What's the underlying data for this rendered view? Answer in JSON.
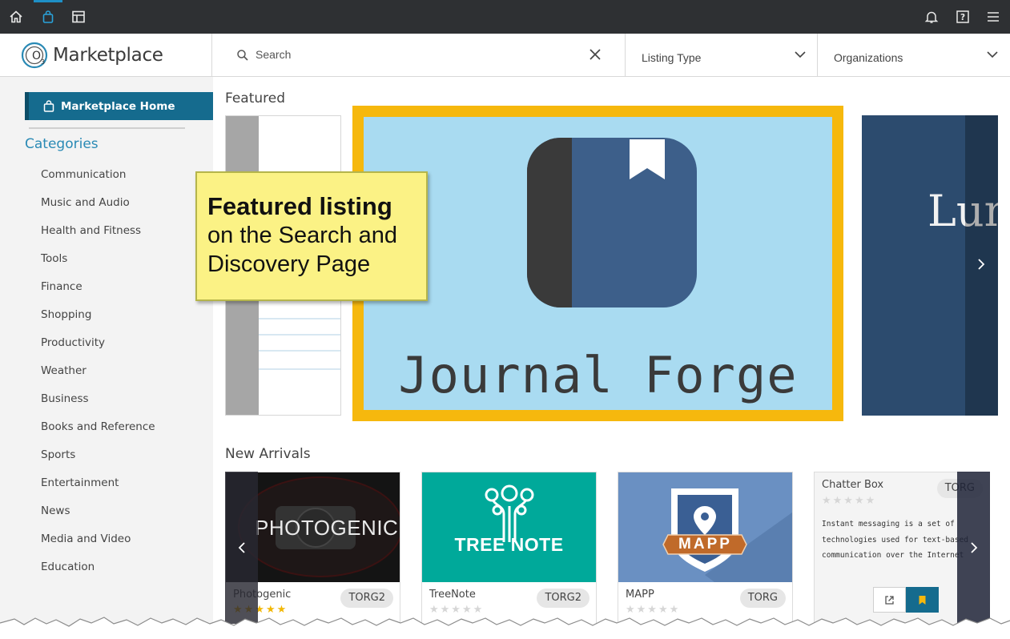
{
  "topbar": {
    "icons": [
      "home-icon",
      "shopping-bag-icon",
      "layout-icon",
      "bell-icon",
      "help-icon",
      "menu-icon"
    ],
    "active_color": "#1e8fc6"
  },
  "header": {
    "logo_text": "Marketplace",
    "logo_mark": "O3",
    "search_placeholder": "Search",
    "listing_type_label": "Listing Type",
    "organizations_label": "Organizations"
  },
  "sidebar": {
    "home_label": "Marketplace Home",
    "categories_title": "Categories",
    "categories": [
      "Communication",
      "Music and Audio",
      "Health and Fitness",
      "Tools",
      "Finance",
      "Shopping",
      "Productivity",
      "Weather",
      "Business",
      "Books and Reference",
      "Sports",
      "Entertainment",
      "News",
      "Media and Video",
      "Education"
    ]
  },
  "featured": {
    "title": "Featured",
    "main_listing": "Journal Forge",
    "next_listing_partial": "Lum",
    "highlight_color": "#f6b80d"
  },
  "callout": {
    "bold": "Featured listing",
    "line2": "on the Search and",
    "line3": "Discovery Page"
  },
  "new_arrivals": {
    "title": "New Arrivals",
    "cards": [
      {
        "name": "Photogenic",
        "org": "TORG2",
        "rating": 5,
        "image_text": "PHOTOGENIC"
      },
      {
        "name": "TreeNote",
        "org": "TORG2",
        "rating": 0,
        "image_text": "TREE NOTE"
      },
      {
        "name": "MAPP",
        "org": "TORG",
        "rating": 0,
        "image_text": "MAPP"
      },
      {
        "name": "Chatter Box",
        "org": "TORG",
        "rating": 0,
        "description": "Instant messaging is a set of technologies used for text-based communication over the Internet"
      }
    ]
  }
}
